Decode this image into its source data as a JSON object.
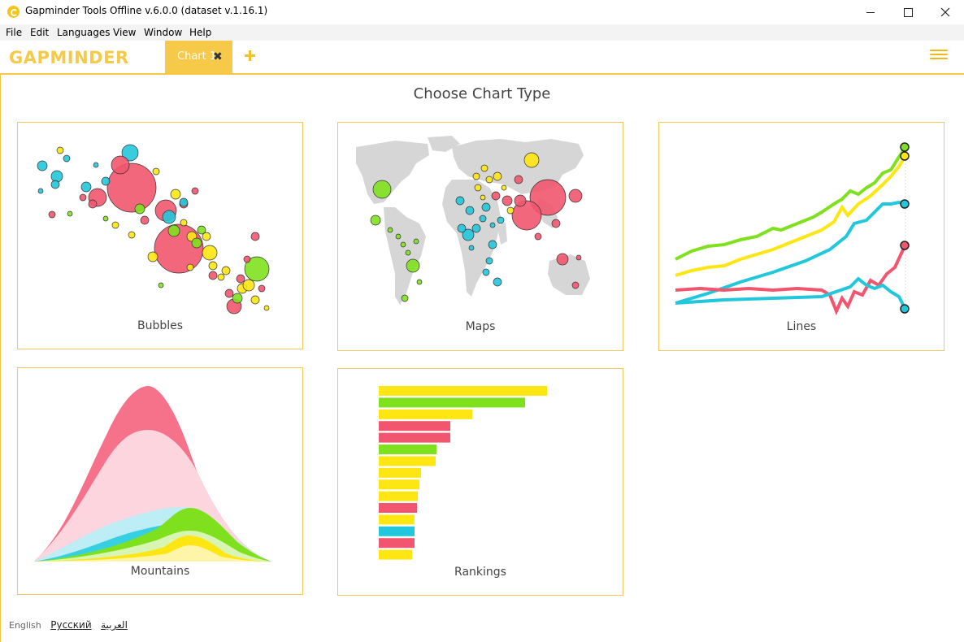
{
  "window": {
    "title": "Gapminder Tools Offline v.6.0.0 (dataset v.1.16.1)"
  },
  "menu": [
    "File",
    "Edit",
    "Languages",
    "View",
    "Window",
    "Help"
  ],
  "header": {
    "tab_label": "Chart 1",
    "accent_color": "#f7c948"
  },
  "page": {
    "title": "Choose Chart Type"
  },
  "charts": [
    {
      "label": "Bubbles"
    },
    {
      "label": "Maps"
    },
    {
      "label": "Lines"
    },
    {
      "label": "Mountains"
    },
    {
      "label": "Rankings"
    }
  ],
  "languages": [
    "English",
    "Русский",
    "العربية"
  ],
  "colors": {
    "pink": "#f1566e",
    "cyan": "#22c7dc",
    "green": "#7fe11e",
    "yellow": "#fde612"
  },
  "icons": [
    "app-logo-icon",
    "close-icon",
    "plus-icon",
    "hamburger-menu-icon"
  ]
}
